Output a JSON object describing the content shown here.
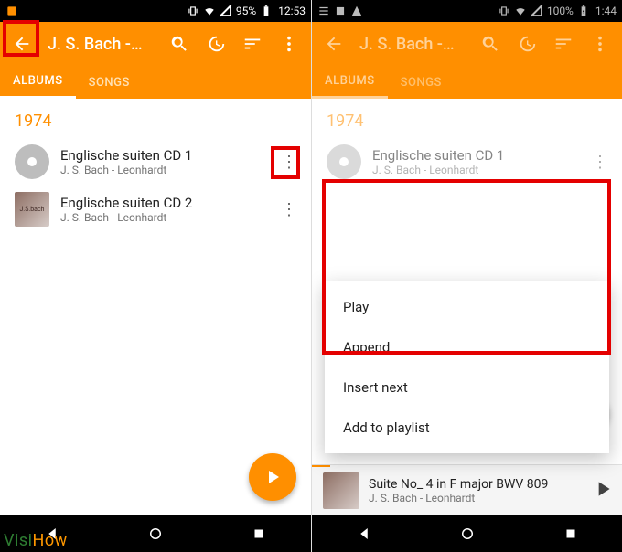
{
  "left": {
    "status": {
      "battery_pct": "95%",
      "time": "12:53"
    },
    "app_title": "J. S. Bach -…",
    "tabs": {
      "albums": "ALBUMS",
      "songs": "SONGS"
    },
    "year": "1974",
    "albums": [
      {
        "title": "Englische suiten CD 1",
        "artist": "J. S. Bach - Leonhardt"
      },
      {
        "title": "Englische suiten CD 2",
        "artist": "J. S. Bach - Leonhardt"
      }
    ]
  },
  "right": {
    "status": {
      "battery_pct": "100%",
      "time": "1:44"
    },
    "app_title": "J. S. Bach -…",
    "tabs": {
      "albums": "ALBUMS",
      "songs": "SONGS"
    },
    "year": "1974",
    "albums": [
      {
        "title": "Englische suiten CD 1",
        "artist": "J. S. Bach - Leonhardt"
      }
    ],
    "context_menu": [
      "Play",
      "Append",
      "Insert next",
      "Add to playlist"
    ],
    "now_playing": {
      "title": "Suite No_ 4 in F major BWV 809",
      "artist": "J. S. Bach - Leonhardt"
    }
  },
  "watermark": {
    "left": "Visi",
    "right": "How"
  }
}
